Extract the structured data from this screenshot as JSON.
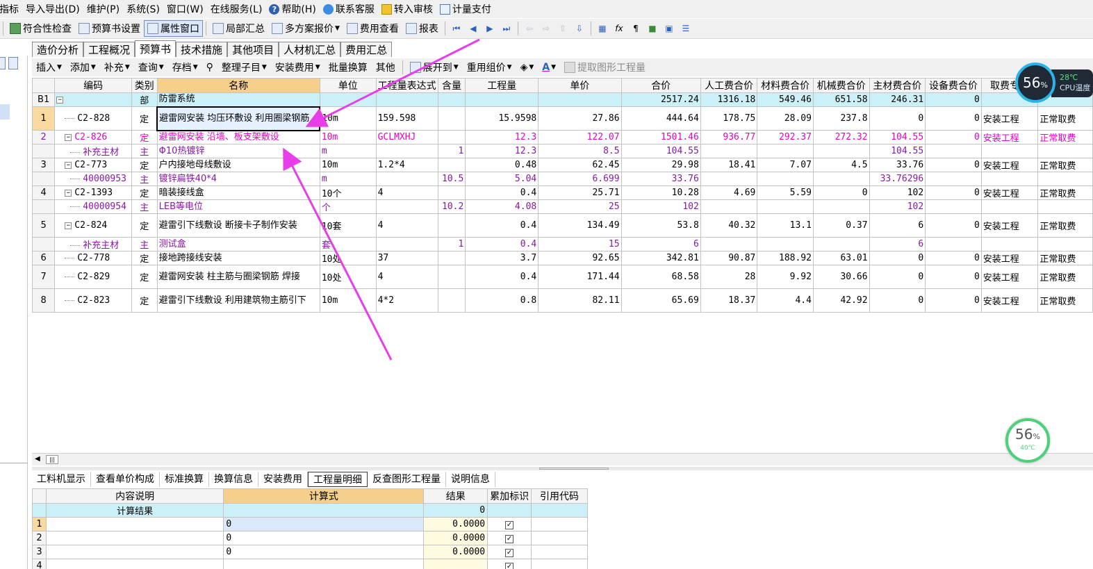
{
  "menu": [
    "指标",
    "导入导出(D)",
    "维护(P)",
    "系统(S)",
    "窗口(W)",
    "在线服务(L)",
    "帮助(H)",
    "联系客服",
    "转入审核",
    "计量支付"
  ],
  "toolbar1": {
    "items": [
      "符合性检查",
      "预算书设置",
      "属性窗口",
      "局部汇总",
      "多方案报价",
      "费用查看",
      "报表"
    ]
  },
  "tabs": [
    "造价分析",
    "工程概况",
    "预算书",
    "技术措施",
    "其他项目",
    "人材机汇总",
    "费用汇总"
  ],
  "active_tab": "预算书",
  "toolbar2": {
    "items": [
      "插入",
      "添加",
      "补充",
      "查询",
      "存档",
      "整理子目",
      "安装费用",
      "批量换算",
      "其他",
      "展开到",
      "重用组价",
      "提取图形工程量"
    ]
  },
  "grid": {
    "headers": [
      "编码",
      "类别",
      "名称",
      "单位",
      "工程量表达式",
      "含量",
      "工程量",
      "单价",
      "合价",
      "人工费合价",
      "材料费合价",
      "机械费合价",
      "主材费合价",
      "设备费合价",
      "取费专业",
      ""
    ],
    "rows": [
      {
        "no": "B1",
        "code": "",
        "type": "部",
        "name": "防雷系统",
        "unit": "",
        "expr": "",
        "content": "",
        "qty": "",
        "price": "",
        "total": "2517.24",
        "labor": "1316.18",
        "material": "549.46",
        "machine": "651.58",
        "main": "246.31",
        "equip": "0",
        "pro": "",
        "fee": ""
      },
      {
        "no": "1",
        "code": "C2-828",
        "type": "定",
        "name": "避雷网安装 均压环敷设 利用圈梁钢筋",
        "unit": "10m",
        "expr": "159.598",
        "content": "",
        "qty": "15.9598",
        "price": "27.86",
        "total": "444.64",
        "labor": "178.75",
        "material": "28.09",
        "machine": "237.8",
        "main": "0",
        "equip": "0",
        "pro": "安装工程",
        "fee": "正常取费"
      },
      {
        "no": "2",
        "code": "C2-826",
        "type": "定",
        "name": "避雷网安装 沿墙、板支架敷设",
        "unit": "10m",
        "expr": "GCLMXHJ",
        "content": "",
        "qty": "12.3",
        "price": "122.07",
        "total": "1501.46",
        "labor": "936.77",
        "material": "292.37",
        "machine": "272.32",
        "main": "104.55",
        "equip": "0",
        "pro": "安装工程",
        "fee": "正常取费"
      },
      {
        "no": "",
        "code": "补充主材",
        "type": "主",
        "name": "Φ10热镀锌",
        "unit": "m",
        "expr": "",
        "content": "1",
        "qty": "12.3",
        "price": "8.5",
        "total": "104.55",
        "labor": "",
        "material": "",
        "machine": "",
        "main": "104.55",
        "equip": "",
        "pro": "",
        "fee": ""
      },
      {
        "no": "3",
        "code": "C2-773",
        "type": "定",
        "name": "户内接地母线敷设",
        "unit": "10m",
        "expr": "1.2*4",
        "content": "",
        "qty": "0.48",
        "price": "62.45",
        "total": "29.98",
        "labor": "18.41",
        "material": "7.07",
        "machine": "4.5",
        "main": "33.76",
        "equip": "0",
        "pro": "安装工程",
        "fee": "正常取费"
      },
      {
        "no": "",
        "code": "40000953",
        "type": "主",
        "name": "镀锌扁铁40*4",
        "unit": "m",
        "expr": "",
        "content": "10.5",
        "qty": "5.04",
        "price": "6.699",
        "total": "33.76",
        "labor": "",
        "material": "",
        "machine": "",
        "main": "33.76296",
        "equip": "",
        "pro": "",
        "fee": ""
      },
      {
        "no": "4",
        "code": "C2-1393",
        "type": "定",
        "name": "暗装接线盒",
        "unit": "10个",
        "expr": "4",
        "content": "",
        "qty": "0.4",
        "price": "25.71",
        "total": "10.28",
        "labor": "4.69",
        "material": "5.59",
        "machine": "0",
        "main": "102",
        "equip": "0",
        "pro": "安装工程",
        "fee": "正常取费"
      },
      {
        "no": "",
        "code": "40000954",
        "type": "主",
        "name": "LEB等电位",
        "unit": "个",
        "expr": "",
        "content": "10.2",
        "qty": "4.08",
        "price": "25",
        "total": "102",
        "labor": "",
        "material": "",
        "machine": "",
        "main": "102",
        "equip": "",
        "pro": "",
        "fee": ""
      },
      {
        "no": "5",
        "code": "C2-824",
        "type": "定",
        "name": "避雷引下线敷设 断接卡子制作安装",
        "unit": "10套",
        "expr": "4",
        "content": "",
        "qty": "0.4",
        "price": "134.49",
        "total": "53.8",
        "labor": "40.32",
        "material": "13.1",
        "machine": "0.37",
        "main": "6",
        "equip": "0",
        "pro": "安装工程",
        "fee": "正常取费"
      },
      {
        "no": "",
        "code": "补充主材",
        "type": "主",
        "name": "测试盒",
        "unit": "套",
        "expr": "",
        "content": "1",
        "qty": "0.4",
        "price": "15",
        "total": "6",
        "labor": "",
        "material": "",
        "machine": "",
        "main": "6",
        "equip": "",
        "pro": "",
        "fee": ""
      },
      {
        "no": "6",
        "code": "C2-778",
        "type": "定",
        "name": "接地跨接线安装",
        "unit": "10处",
        "expr": "37",
        "content": "",
        "qty": "3.7",
        "price": "92.65",
        "total": "342.81",
        "labor": "90.87",
        "material": "188.92",
        "machine": "63.01",
        "main": "0",
        "equip": "0",
        "pro": "安装工程",
        "fee": "正常取费"
      },
      {
        "no": "7",
        "code": "C2-829",
        "type": "定",
        "name": "避雷网安装 柱主筋与圈梁钢筋 焊接",
        "unit": "10处",
        "expr": "4",
        "content": "",
        "qty": "0.4",
        "price": "171.44",
        "total": "68.58",
        "labor": "28",
        "material": "9.92",
        "machine": "30.66",
        "main": "0",
        "equip": "0",
        "pro": "安装工程",
        "fee": "正常取费"
      },
      {
        "no": "8",
        "code": "C2-823",
        "type": "定",
        "name": "避雷引下线敷设 利用建筑物主筋引下",
        "unit": "10m",
        "expr": "4*2",
        "content": "",
        "qty": "0.8",
        "price": "82.11",
        "total": "65.69",
        "labor": "18.37",
        "material": "4.4",
        "machine": "42.92",
        "main": "0",
        "equip": "0",
        "pro": "安装工程",
        "fee": "正常取费"
      }
    ]
  },
  "bottom_tabs": [
    "工料机显示",
    "查看单价构成",
    "标准换算",
    "换算信息",
    "安装费用",
    "工程量明细",
    "反查图形工程量",
    "说明信息"
  ],
  "bottom_active": "工程量明细",
  "bottom_grid": {
    "headers": [
      "内容说明",
      "计算式",
      "结果",
      "累加标识",
      "引用代码"
    ],
    "result_label": "计算结果",
    "result_value": "0",
    "rows": [
      {
        "no": "1",
        "formula": "0",
        "result": "0.0000",
        "checked": true
      },
      {
        "no": "2",
        "formula": "0",
        "result": "0.0000",
        "checked": true
      },
      {
        "no": "3",
        "formula": "0",
        "result": "0.0000",
        "checked": true
      },
      {
        "no": "4",
        "formula": "",
        "result": "",
        "checked": true
      }
    ]
  },
  "cpu_widget": {
    "percent": "56",
    "unit": "%",
    "temp": "28℃",
    "label": "CPU温度"
  },
  "cpu_widget2": {
    "percent": "56",
    "unit": "%",
    "temp": "40℃"
  },
  "colors": {
    "header_highlight": "#f7cf8c",
    "group_row": "#ccf0f7",
    "pink_text": "#e600c8",
    "purple_text": "#8a17a8",
    "arrow": "#e83de8"
  }
}
